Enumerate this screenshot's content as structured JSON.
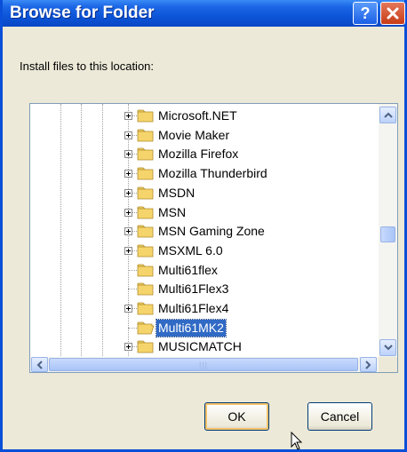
{
  "window": {
    "title": "Browse for Folder",
    "help_label": "?",
    "titlebar_color": "#0a4fd8"
  },
  "prompt": "Install files to this location:",
  "tree": {
    "items": [
      {
        "label": "Microsoft.NET",
        "expandable": true,
        "selected": false
      },
      {
        "label": "Movie Maker",
        "expandable": true,
        "selected": false
      },
      {
        "label": "Mozilla Firefox",
        "expandable": true,
        "selected": false
      },
      {
        "label": "Mozilla Thunderbird",
        "expandable": true,
        "selected": false
      },
      {
        "label": "MSDN",
        "expandable": true,
        "selected": false
      },
      {
        "label": "MSN",
        "expandable": true,
        "selected": false
      },
      {
        "label": "MSN Gaming Zone",
        "expandable": true,
        "selected": false
      },
      {
        "label": "MSXML 6.0",
        "expandable": true,
        "selected": false
      },
      {
        "label": "Multi61flex",
        "expandable": false,
        "selected": false
      },
      {
        "label": "Multi61Flex3",
        "expandable": false,
        "selected": false
      },
      {
        "label": "Multi61Flex4",
        "expandable": true,
        "selected": false
      },
      {
        "label": "Multi61MK2",
        "expandable": false,
        "selected": true
      },
      {
        "label": "MUSICMATCH",
        "expandable": true,
        "selected": false
      }
    ],
    "selection_color": "#316ac5",
    "folder_color": "#f5d56b"
  },
  "buttons": {
    "ok_label": "OK",
    "cancel_label": "Cancel"
  }
}
